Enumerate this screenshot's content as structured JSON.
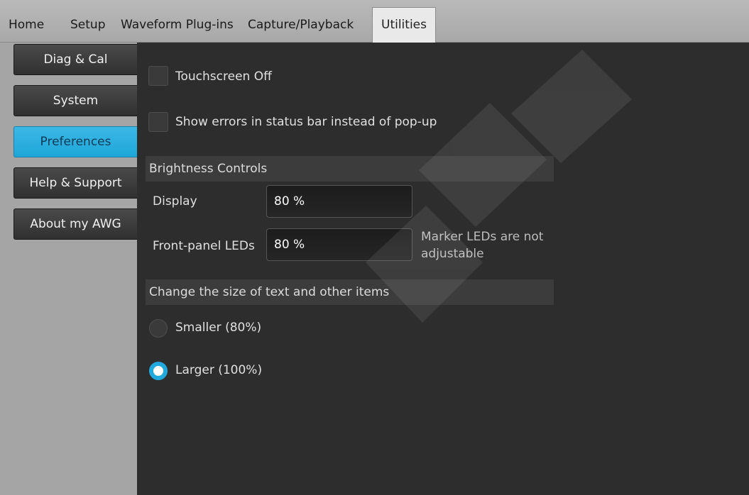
{
  "menubar": {
    "items": [
      "Home",
      "Setup",
      "Waveform Plug-ins",
      "Capture/Playback",
      "Utilities"
    ],
    "active": "Utilities"
  },
  "sidebar": {
    "items": [
      {
        "label": "Diag & Cal"
      },
      {
        "label": "System"
      },
      {
        "label": "Preferences"
      },
      {
        "label": "Help & Support"
      },
      {
        "label": "About my AWG"
      }
    ],
    "active": "Preferences"
  },
  "preferences": {
    "touchscreen_off": {
      "label": "Touchscreen Off",
      "checked": false
    },
    "show_errors": {
      "label": "Show errors in status bar instead of pop-up",
      "checked": false
    },
    "brightness": {
      "header": "Brightness Controls",
      "display": {
        "label": "Display",
        "value": "80 %"
      },
      "front_panel": {
        "label": "Front-panel LEDs",
        "value": "80 %"
      },
      "note": "Marker LEDs are not adjustable"
    },
    "text_size": {
      "header": "Change the size of text and other items",
      "options": [
        {
          "label": "Smaller (80%)",
          "selected": false
        },
        {
          "label": "Larger (100%)",
          "selected": true
        }
      ]
    }
  },
  "colors": {
    "accent": "#21a8dd",
    "background": "#2d2d2d",
    "sidebar": "#a5a5a5",
    "menubar": "#b0b0b0"
  }
}
